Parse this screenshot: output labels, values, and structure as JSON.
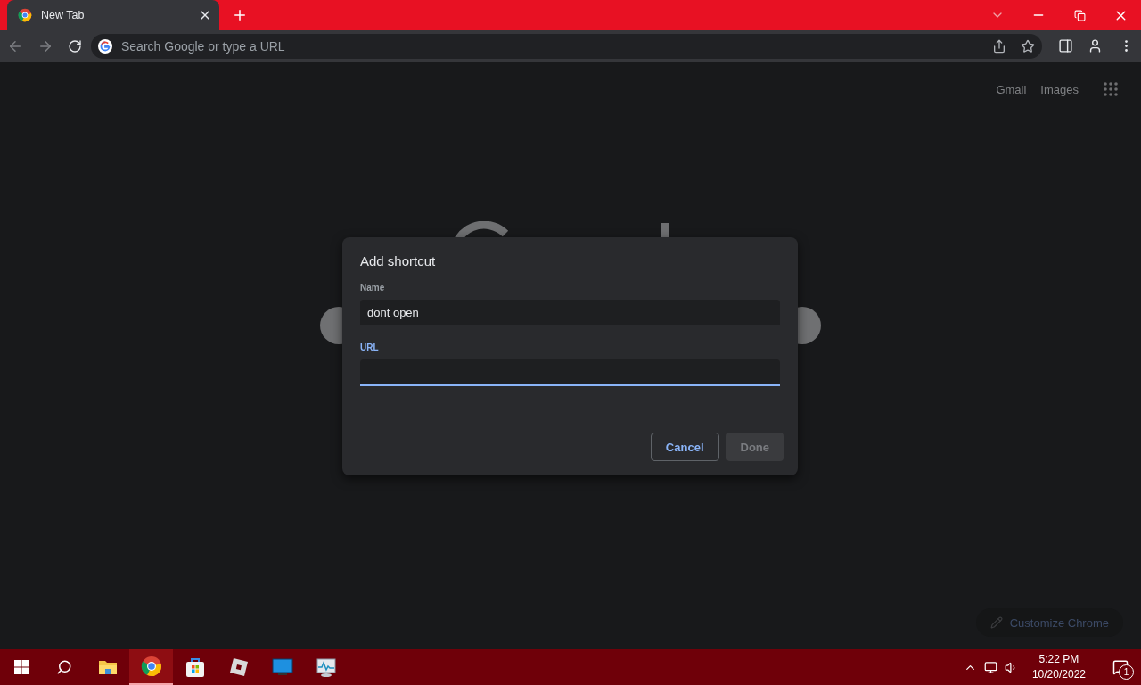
{
  "tab": {
    "title": "New Tab",
    "selected": true
  },
  "omnibox": {
    "placeholder": "Search Google or type a URL"
  },
  "page": {
    "links": [
      "Gmail",
      "Images"
    ],
    "customize": "Customize Chrome"
  },
  "dialog": {
    "title": "Add shortcut",
    "fields": [
      {
        "label": "Name",
        "value": "dont open",
        "focused": false
      },
      {
        "label": "URL",
        "focused": true
      }
    ],
    "buttons": [
      {
        "label": "Cancel",
        "kind": "secondary",
        "disabled": false
      },
      {
        "label": "Done",
        "kind": "primary",
        "disabled": true
      }
    ]
  },
  "taskbar": {
    "apps": [
      {
        "kind": "explorer",
        "active": false
      },
      {
        "kind": "chrome",
        "active": true
      },
      {
        "kind": "store",
        "active": false
      },
      {
        "kind": "roblox",
        "active": false
      },
      {
        "kind": "monitor",
        "active": false
      },
      {
        "kind": "taskmanager",
        "active": false
      }
    ],
    "time": "5:22 PM",
    "date": "10/20/2022",
    "notifications": "1"
  }
}
